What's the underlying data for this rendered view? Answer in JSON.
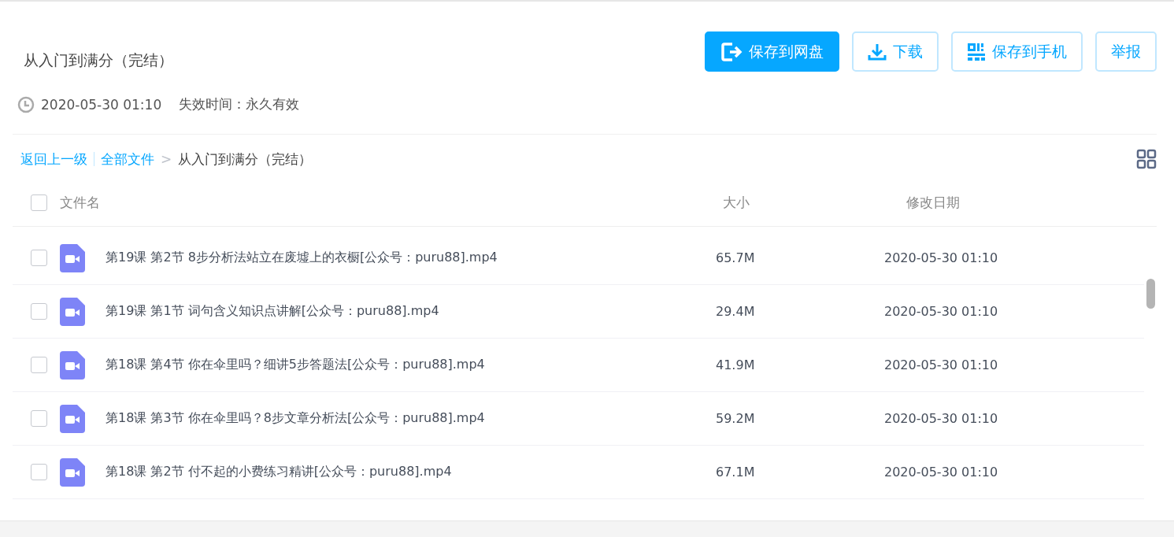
{
  "share": {
    "title": "从入门到满分（完结）",
    "time": "2020-05-30 01:10",
    "expiry": "失效时间：永久有效"
  },
  "actions": [
    {
      "kind": "save",
      "label": "保存到网盘"
    },
    {
      "kind": "download",
      "label": "下载"
    },
    {
      "kind": "phone",
      "label": "保存到手机"
    },
    {
      "kind": "report",
      "label": "举报"
    }
  ],
  "breadcrumb": {
    "back": "返回上一级",
    "root": "全部文件",
    "separator": ">",
    "current": "从入门到满分（完结）"
  },
  "table": {
    "columns": [
      "文件名",
      "大小",
      "修改日期"
    ],
    "all_checked": false,
    "rows": [
      {
        "name": "第19课 第2节 8步分析法站立在废墟上的衣橱[公众号：puru88].mp4",
        "size": "65.7M",
        "date": "2020-05-30 01:10",
        "checked": false
      },
      {
        "name": "第19课 第1节 词句含义知识点讲解[公众号：puru88].mp4",
        "size": "29.4M",
        "date": "2020-05-30 01:10",
        "checked": false
      },
      {
        "name": "第18课 第4节 你在伞里吗？细讲5步答题法[公众号：puru88].mp4",
        "size": "41.9M",
        "date": "2020-05-30 01:10",
        "checked": false
      },
      {
        "name": "第18课 第3节 你在伞里吗？8步文章分析法[公众号：puru88].mp4",
        "size": "59.2M",
        "date": "2020-05-30 01:10",
        "checked": false
      },
      {
        "name": "第18课 第2节 付不起的小费练习精讲[公众号：puru88].mp4",
        "size": "67.1M",
        "date": "2020-05-30 01:10",
        "checked": false
      }
    ]
  }
}
